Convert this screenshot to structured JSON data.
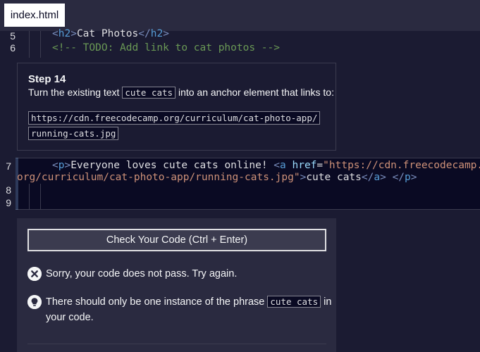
{
  "tab": {
    "label": "index.html"
  },
  "editor": {
    "lines": {
      "l5": {
        "num": "5",
        "open": "<",
        "tag": "h2",
        "close1": ">",
        "text": "Cat Photos",
        "open2": "</",
        "tag2": "h2",
        "close2": ">"
      },
      "l6": {
        "num": "6",
        "comment": "<!-- TODO: Add link to cat photos -->"
      },
      "l7": {
        "num": "7",
        "p_open": "<",
        "p_tag": "p",
        "p_close": ">",
        "text1": "Everyone loves cute cats online! ",
        "a_open": "<",
        "a_tag": "a",
        "attr": " href",
        "eq": "=",
        "url_part1": "\"https://cdn.freecodecamp.",
        "url_part2": "org/curriculum/cat-photo-app/running-cats.jpg\"",
        "a_close": ">",
        "link_text": "cute cats",
        "a_end_open": "</",
        "a_end_tag": "a",
        "a_end_close": ">",
        "space": " ",
        "p_end_open": "</",
        "p_end_tag": "p",
        "p_end_close": ">"
      },
      "l8": {
        "num": "8"
      },
      "l9": {
        "num": "9"
      }
    }
  },
  "description": {
    "title": "Step 14",
    "text_before": "Turn the existing text ",
    "code": "cute cats",
    "text_after": " into an anchor element that links to:",
    "url_line1": "https://cdn.freecodecamp.org/curriculum/cat-photo-app/",
    "url_line2": "running-cats.jpg"
  },
  "results": {
    "check_button": "Check Your Code (Ctrl + Enter)",
    "error_text": "Sorry, your code does not pass. Try again.",
    "hint_before": "There should only be one instance of the phrase ",
    "hint_code": "cute cats",
    "hint_after": " in",
    "hint_line2": "your code."
  },
  "colors": {
    "background": "#1b1b32",
    "panel": "#2a2a40",
    "accent": "#99c9ff"
  },
  "icons": {
    "error": "x-circle-icon",
    "hint": "lightbulb-icon"
  }
}
